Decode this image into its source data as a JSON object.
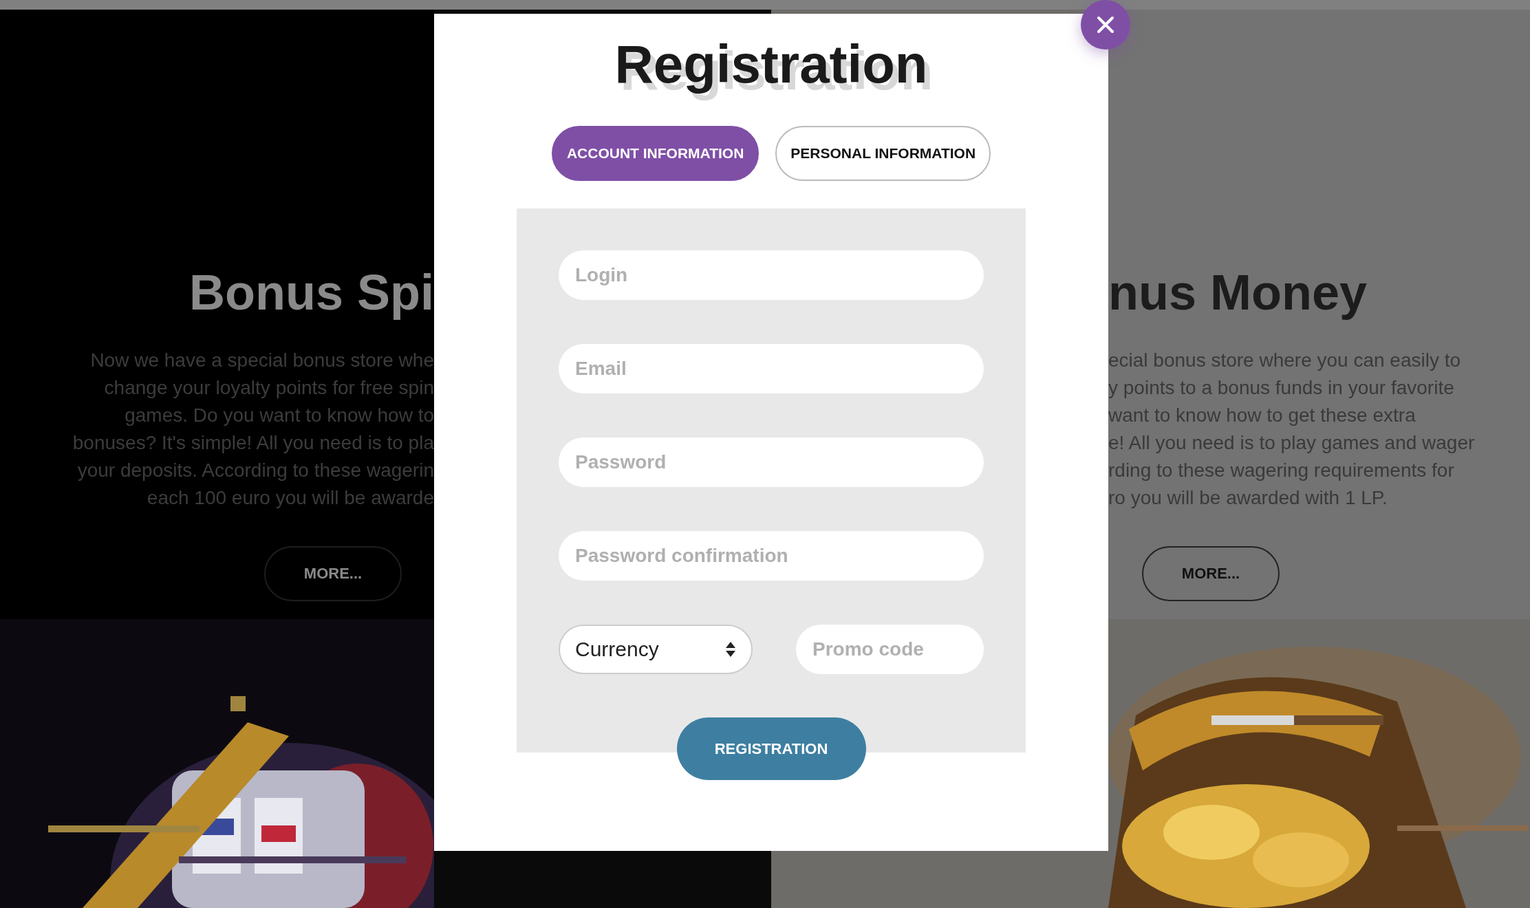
{
  "background": {
    "left": {
      "heading": "Bonus Spi",
      "lines": [
        "Now we have a special bonus store whe",
        "change your loyalty points for free spin",
        "games. Do you want to know how to",
        "bonuses? It's simple! All you need is to pla",
        "your deposits. According to these wagerin",
        "each 100 euro you will be awarde"
      ],
      "button": "MORE..."
    },
    "right": {
      "heading": "nus Money",
      "lines": [
        "ecial bonus store where you can easily to",
        "y points to a bonus funds in your favorite",
        "want to know how to get these extra",
        "e! All you need is to play games and wager",
        "rding to these wagering requirements for",
        "ro you will be awarded with 1 LP."
      ],
      "button": "MORE..."
    }
  },
  "modal": {
    "title": "Registration",
    "tabs": [
      {
        "label": "ACCOUNT INFORMATION",
        "selected": true
      },
      {
        "label": "PERSONAL INFORMATION",
        "selected": false
      }
    ],
    "fields": [
      {
        "placeholder": "Login"
      },
      {
        "placeholder": "Email"
      },
      {
        "placeholder": "Password"
      },
      {
        "placeholder": "Password confirmation"
      }
    ],
    "currency_select": {
      "value": "Currency"
    },
    "promo_code": {
      "placeholder": "Promo code"
    },
    "submit": "REGISTRATION"
  }
}
